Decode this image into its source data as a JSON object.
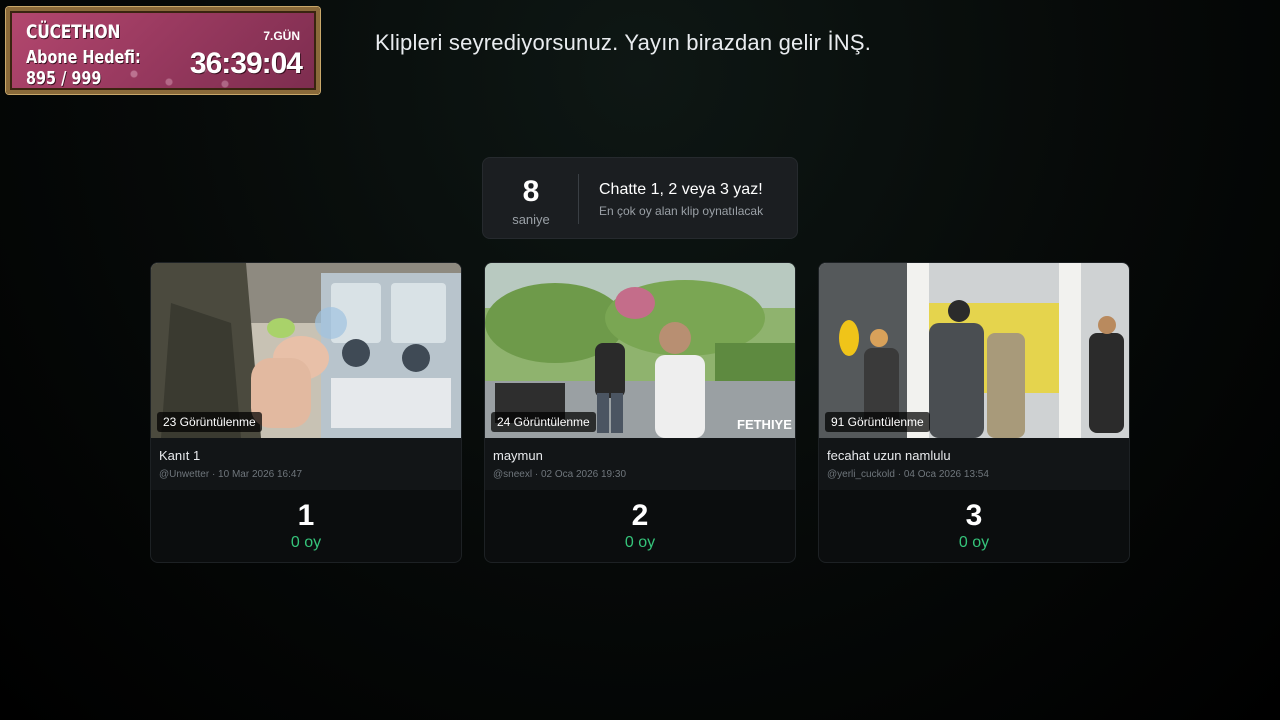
{
  "widget": {
    "title": "CÜCETHON",
    "day": "7.GÜN",
    "goal_label": "Abone Hedefi:",
    "goal_count": "895 / 999",
    "timer": "36:39:04"
  },
  "headline": "Klipleri seyrediyorsunuz. Yayın birazdan gelir İNŞ.",
  "countdown": {
    "value": "8",
    "unit": "saniye",
    "title": "Chatte 1, 2 veya 3 yaz!",
    "subtitle": "En çok oy alan klip oynatılacak"
  },
  "clips": [
    {
      "views": "23 Görüntülenme",
      "title": "Kanıt 1",
      "meta": "@Unwetter · 10 Mar 2026 16:47",
      "slot": "1",
      "votes": "0 oy"
    },
    {
      "views": "24 Görüntülenme",
      "title": "maymun",
      "meta": "@sneexl · 02 Oca 2026 19:30",
      "slot": "2",
      "votes": "0 oy"
    },
    {
      "views": "91 Görüntülenme",
      "title": "fecahat uzun namlulu",
      "meta": "@yerli_cuckold · 04 Oca 2026 13:54",
      "slot": "3",
      "votes": "0 oy"
    }
  ]
}
